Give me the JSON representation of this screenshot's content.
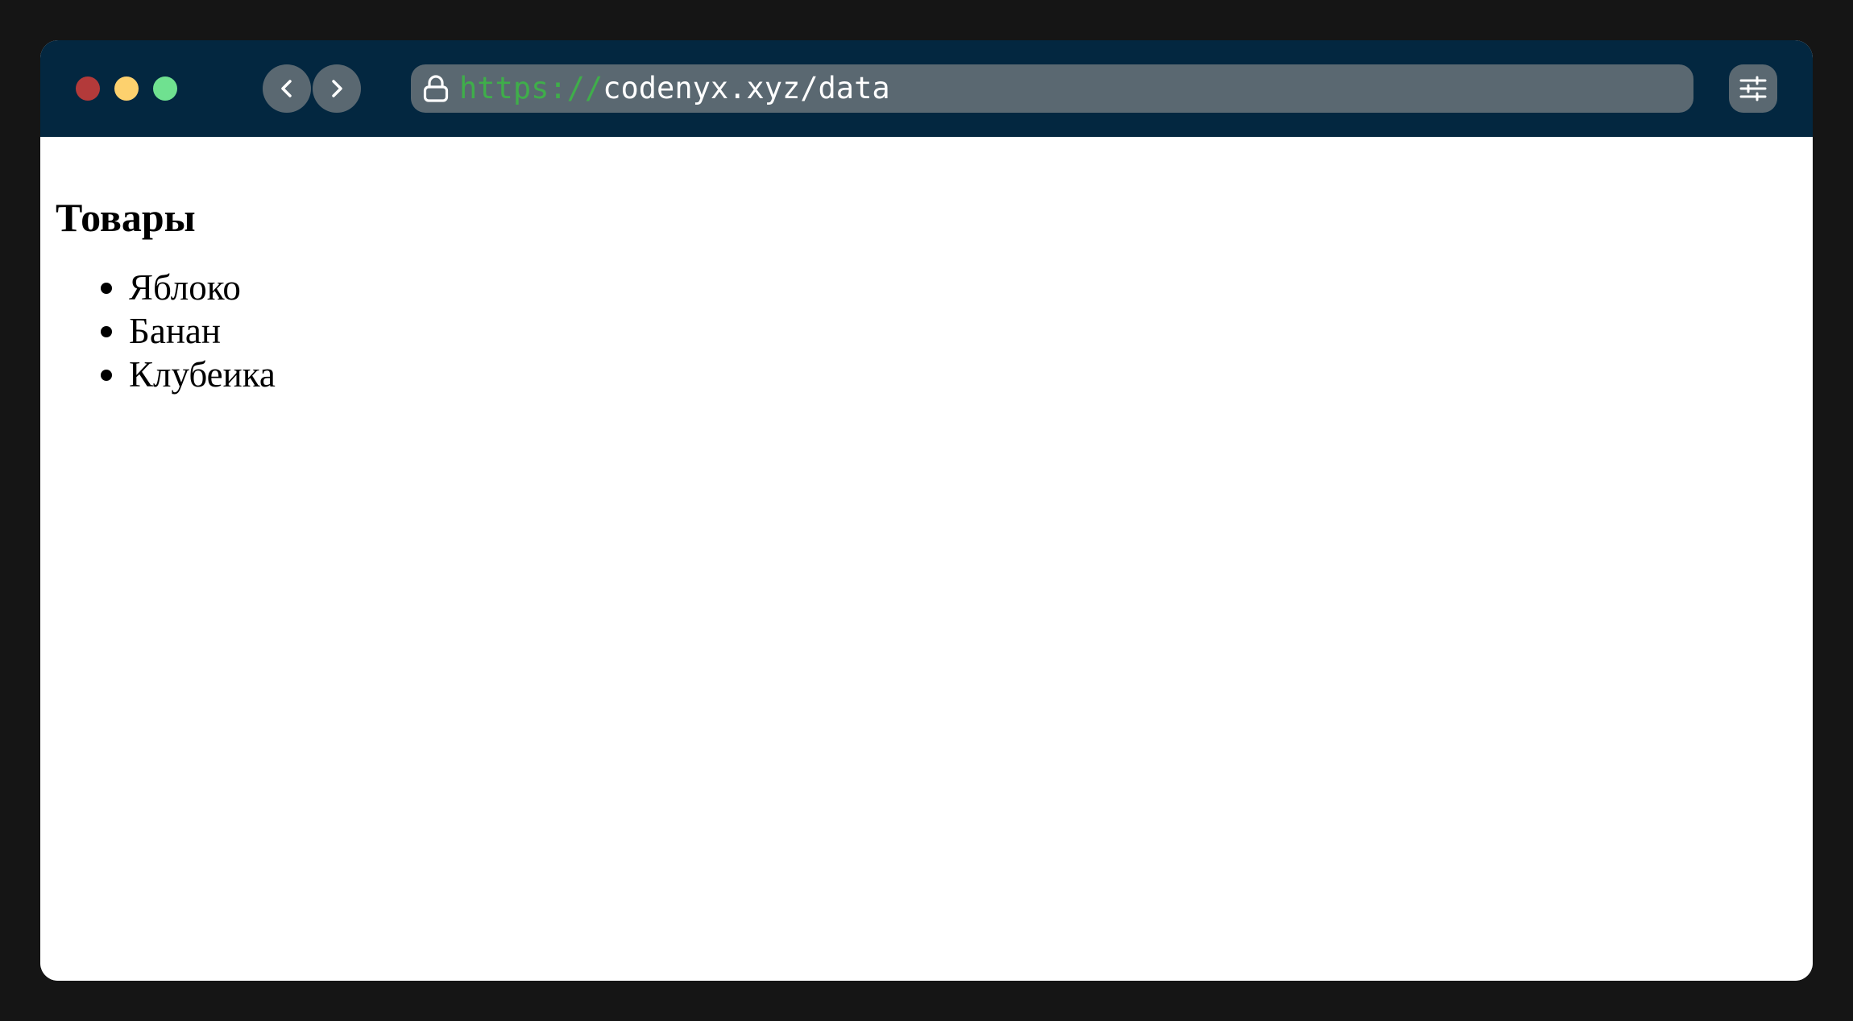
{
  "window": {
    "traffic_lights": {
      "close_color": "#b33a3a",
      "minimize_color": "#fdd16e",
      "zoom_color": "#6fe190"
    },
    "title_bar_color": "#032740"
  },
  "toolbar": {
    "back_icon": "chevron-left-icon",
    "forward_icon": "chevron-right-icon",
    "settings_icon": "sliders-icon"
  },
  "address_bar": {
    "lock_icon": "lock-icon",
    "url_scheme": "https://",
    "url_rest": "codenyx.xyz/data",
    "scheme_color": "#3fae4a"
  },
  "page": {
    "heading": "Товары",
    "items": [
      {
        "label": "Яблоко"
      },
      {
        "label": "Банан"
      },
      {
        "label": "Клубеика"
      }
    ]
  }
}
